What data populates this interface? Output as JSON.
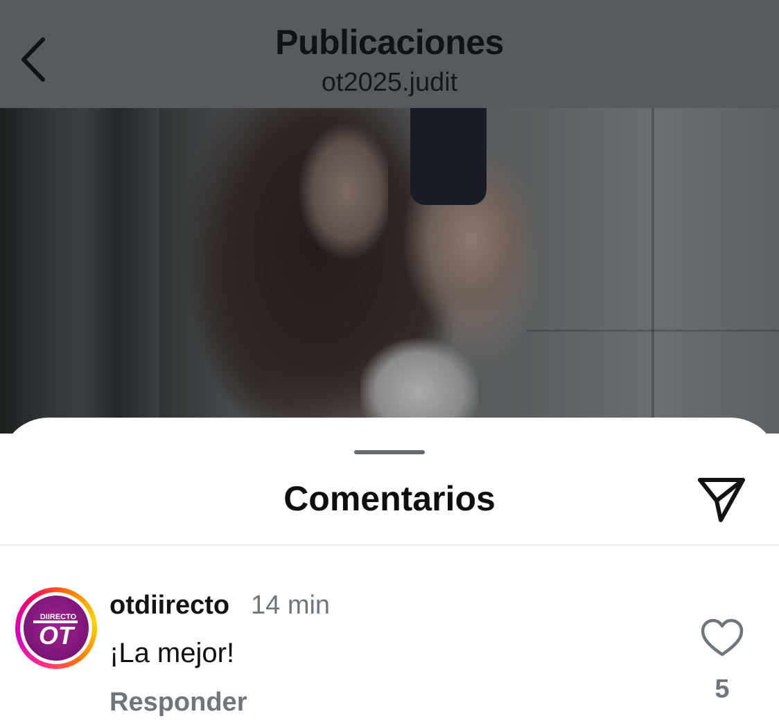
{
  "header": {
    "title": "Publicaciones",
    "subtitle": "ot2025.judit",
    "back_icon": "chevron-left-icon"
  },
  "photo": {
    "description_icon": "post-photo"
  },
  "comments_sheet": {
    "title": "Comentarios",
    "share_icon": "paper-plane-icon",
    "comments": [
      {
        "username": "otdiirecto",
        "time": "14 min",
        "text": "¡La mejor!",
        "reply_label": "Responder",
        "likes": "5",
        "like_icon": "heart-outline-icon",
        "avatar": {
          "logo_text": "DIIRECTO",
          "logo_mark": "OT"
        }
      }
    ]
  },
  "colors": {
    "header_bg": "#575b5f",
    "muted_text": "#6e767c",
    "avatar_ring": [
      "#ff2d8a",
      "#d300c5",
      "#ff7a00",
      "#ffd600"
    ],
    "logo_bg": "#8a1a82"
  }
}
